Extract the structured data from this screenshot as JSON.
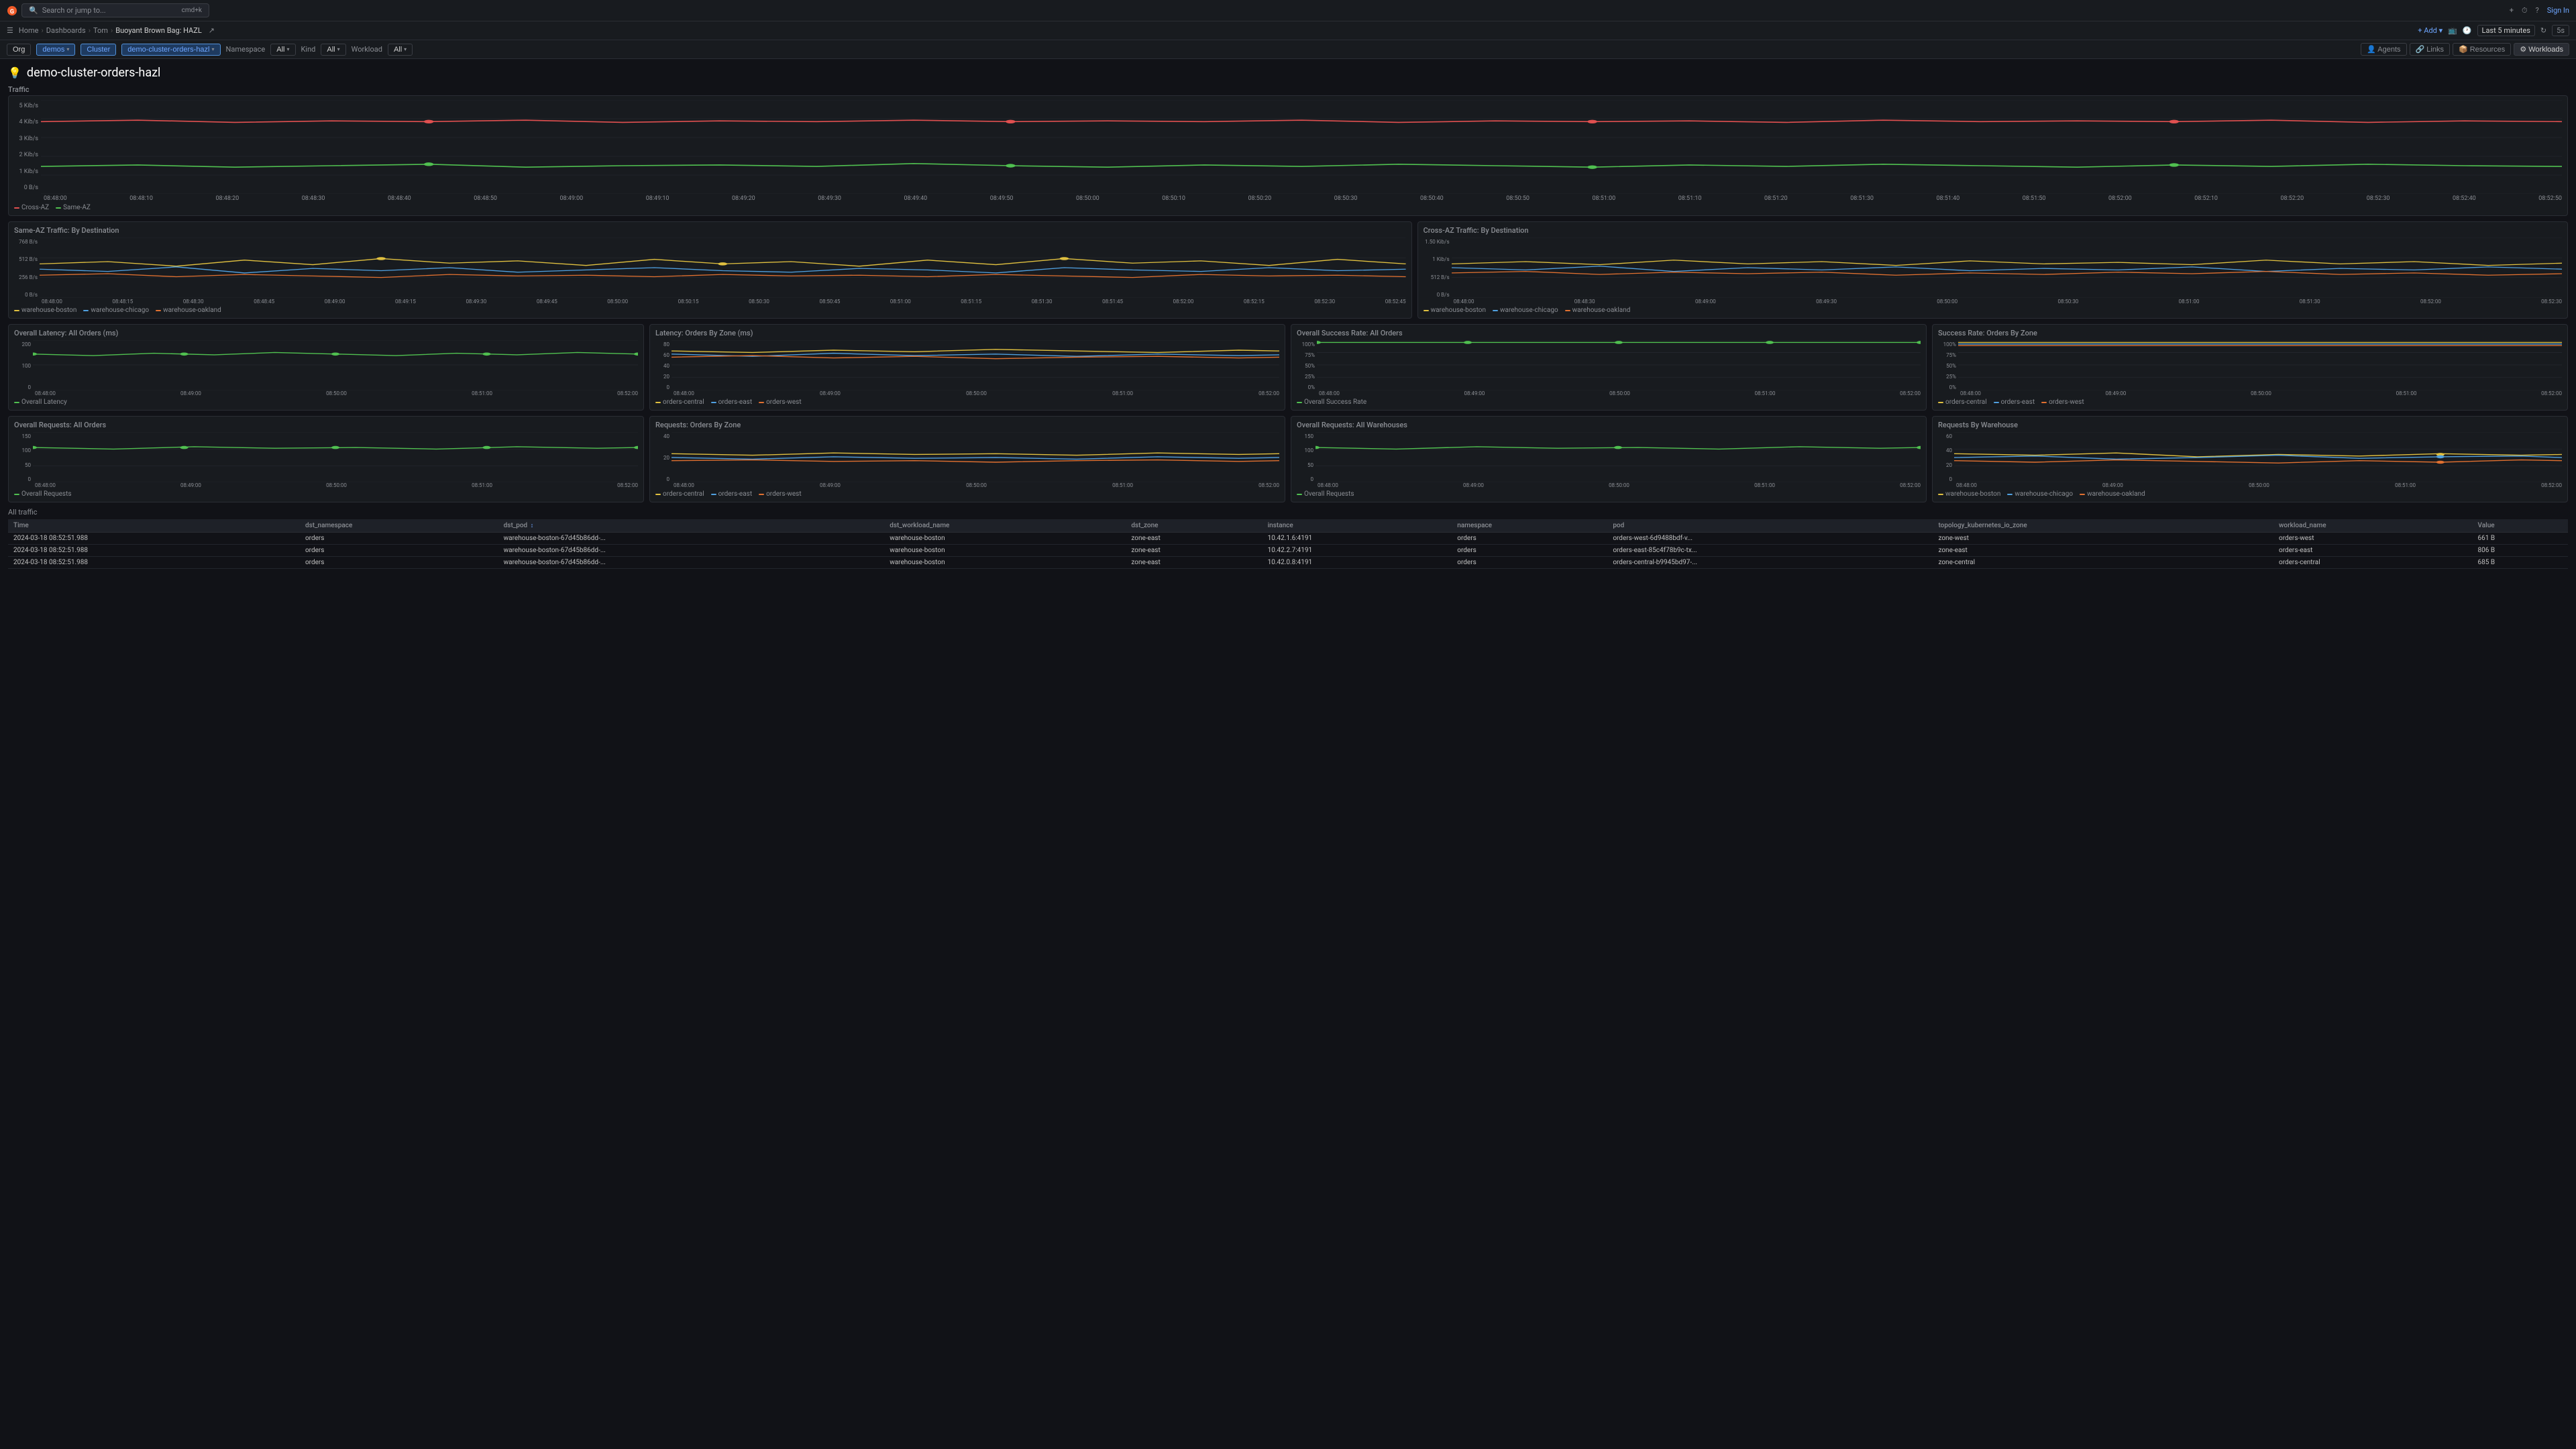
{
  "app": {
    "logo_text": "G",
    "search_placeholder": "Search or jump to...",
    "search_shortcut": "cmd+k",
    "topbar_actions": [
      "+",
      "⏱",
      "?",
      "Sign In"
    ],
    "add_label": "+ Add",
    "last_refresh": "Last 5 minutes",
    "refresh_interval": "5s"
  },
  "breadcrumb": {
    "home": "Home",
    "dashboards": "Dashboards",
    "user": "Tom",
    "current": "Buoyant Brown Bag: HAZL",
    "share_icon": "share"
  },
  "filters": {
    "org": "Org",
    "demos": "demos",
    "cluster": "Cluster",
    "cluster_value": "demo-cluster-orders-hazl",
    "namespace_label": "Namespace",
    "namespace_value": "All",
    "kind_label": "Kind",
    "kind_value": "All",
    "workload_label": "Workload",
    "workload_value": "All"
  },
  "nav_buttons": [
    {
      "label": "Agents",
      "icon": "👤"
    },
    {
      "label": "Links",
      "icon": "🔗"
    },
    {
      "label": "Resources",
      "icon": "📦"
    },
    {
      "label": "Workloads",
      "icon": "⚙"
    }
  ],
  "page": {
    "icon": "💡",
    "title": "demo-cluster-orders-hazl"
  },
  "traffic_section": {
    "label": "Traffic",
    "y_labels": [
      "5 Kib/s",
      "4 Kib/s",
      "3 Kib/s",
      "2 Kib/s",
      "1 Kib/s",
      "0 B/s"
    ],
    "legend": [
      {
        "label": "Cross-AZ",
        "color": "#e05050"
      },
      {
        "label": "Same-AZ",
        "color": "#50c050"
      }
    ]
  },
  "same_az_chart": {
    "title": "Same-AZ Traffic: By Destination",
    "y_labels": [
      "768 B/s",
      "512 B/s",
      "256 B/s",
      "0 B/s"
    ],
    "legend": [
      {
        "label": "warehouse-boston",
        "color": "#e0c040"
      },
      {
        "label": "warehouse-chicago",
        "color": "#50a0e0"
      },
      {
        "label": "warehouse-oakland",
        "color": "#e07030"
      }
    ]
  },
  "cross_az_chart": {
    "title": "Cross-AZ Traffic: By Destination",
    "y_labels": [
      "1.50 Kib/s",
      "1 Kib/s",
      "512 B/s",
      "0 B/s"
    ],
    "legend": [
      {
        "label": "warehouse-boston",
        "color": "#e0c040"
      },
      {
        "label": "warehouse-chicago",
        "color": "#50a0e0"
      },
      {
        "label": "warehouse-oakland",
        "color": "#e07030"
      }
    ]
  },
  "overall_latency_chart": {
    "title": "Overall Latency: All Orders (ms)",
    "y_labels": [
      "200",
      "100",
      "0"
    ],
    "legend": [
      {
        "label": "Overall Latency",
        "color": "#50c050"
      }
    ]
  },
  "latency_zone_chart": {
    "title": "Latency: Orders By Zone (ms)",
    "y_labels": [
      "80",
      "60",
      "40",
      "20",
      "0"
    ],
    "legend": [
      {
        "label": "orders-central",
        "color": "#e0c040"
      },
      {
        "label": "orders-east",
        "color": "#50a0e0"
      },
      {
        "label": "orders-west",
        "color": "#e07030"
      }
    ]
  },
  "overall_success_chart": {
    "title": "Overall Success Rate: All Orders",
    "y_labels": [
      "100%",
      "75%",
      "50%",
      "25%",
      "0%"
    ],
    "legend": [
      {
        "label": "Overall Success Rate",
        "color": "#50c050"
      }
    ]
  },
  "success_zone_chart": {
    "title": "Success Rate: Orders By Zone",
    "y_labels": [
      "100%",
      "75%",
      "50%",
      "25%",
      "0%"
    ],
    "legend": [
      {
        "label": "orders-central",
        "color": "#e0c040"
      },
      {
        "label": "orders-east",
        "color": "#50a0e0"
      },
      {
        "label": "orders-west",
        "color": "#e07030"
      }
    ]
  },
  "overall_requests_chart": {
    "title": "Overall Requests: All Orders",
    "y_labels": [
      "150",
      "100",
      "50",
      "0"
    ],
    "legend": [
      {
        "label": "Overall Requests",
        "color": "#50c050"
      }
    ]
  },
  "requests_zone_chart": {
    "title": "Requests: Orders By Zone",
    "y_labels": [
      "40",
      "20",
      "0"
    ],
    "legend": [
      {
        "label": "orders-central",
        "color": "#e0c040"
      },
      {
        "label": "orders-east",
        "color": "#50a0e0"
      },
      {
        "label": "orders-west",
        "color": "#e07030"
      }
    ]
  },
  "overall_warehouse_chart": {
    "title": "Overall Requests: All Warehouses",
    "y_labels": [
      "150",
      "100",
      "50",
      "0"
    ],
    "legend": [
      {
        "label": "Overall Requests",
        "color": "#50c050"
      }
    ]
  },
  "requests_warehouse_chart": {
    "title": "Requests By Warehouse",
    "y_labels": [
      "60",
      "40",
      "20",
      "0"
    ],
    "legend": [
      {
        "label": "warehouse-boston",
        "color": "#e0c040"
      },
      {
        "label": "warehouse-chicago",
        "color": "#50a0e0"
      },
      {
        "label": "warehouse-oakland",
        "color": "#e07030"
      }
    ]
  },
  "table": {
    "section_label": "All traffic",
    "columns": [
      {
        "key": "time",
        "label": "Time"
      },
      {
        "key": "dst_namespace",
        "label": "dst_namespace"
      },
      {
        "key": "dst_pod",
        "label": "dst_pod",
        "sortable": true
      },
      {
        "key": "dst_workload_name",
        "label": "dst_workload_name"
      },
      {
        "key": "dst_zone",
        "label": "dst_zone"
      },
      {
        "key": "instance",
        "label": "instance"
      },
      {
        "key": "namespace",
        "label": "namespace"
      },
      {
        "key": "pod",
        "label": "pod"
      },
      {
        "key": "topology_kubernetes_io_zone",
        "label": "topology_kubernetes_io_zone"
      },
      {
        "key": "workload_name",
        "label": "workload_name"
      },
      {
        "key": "value",
        "label": "Value"
      }
    ],
    "rows": [
      {
        "time": "2024-03-18 08:52:51.988",
        "dst_namespace": "orders",
        "dst_pod": "warehouse-boston-67d45b86dd-...",
        "dst_workload_name": "warehouse-boston",
        "dst_zone": "zone-east",
        "instance": "10.42.1.6:4191",
        "namespace": "orders",
        "pod": "orders-west-6d9488bdf-v...",
        "topology_kubernetes_io_zone": "zone-west",
        "workload_name": "orders-west",
        "value": "661 B"
      },
      {
        "time": "2024-03-18 08:52:51.988",
        "dst_namespace": "orders",
        "dst_pod": "warehouse-boston-67d45b86dd-...",
        "dst_workload_name": "warehouse-boston",
        "dst_zone": "zone-east",
        "instance": "10.42.2.7:4191",
        "namespace": "orders",
        "pod": "orders-east-85c4f78b9c-tx...",
        "topology_kubernetes_io_zone": "zone-east",
        "workload_name": "orders-east",
        "value": "806 B"
      },
      {
        "time": "2024-03-18 08:52:51.988",
        "dst_namespace": "orders",
        "dst_pod": "warehouse-boston-67d45b86dd-...",
        "dst_workload_name": "warehouse-boston",
        "dst_zone": "zone-east",
        "instance": "10.42.0.8:4191",
        "namespace": "orders",
        "pod": "orders-central-b9945bd97-...",
        "topology_kubernetes_io_zone": "zone-central",
        "workload_name": "orders-central",
        "value": "685 B"
      }
    ]
  }
}
